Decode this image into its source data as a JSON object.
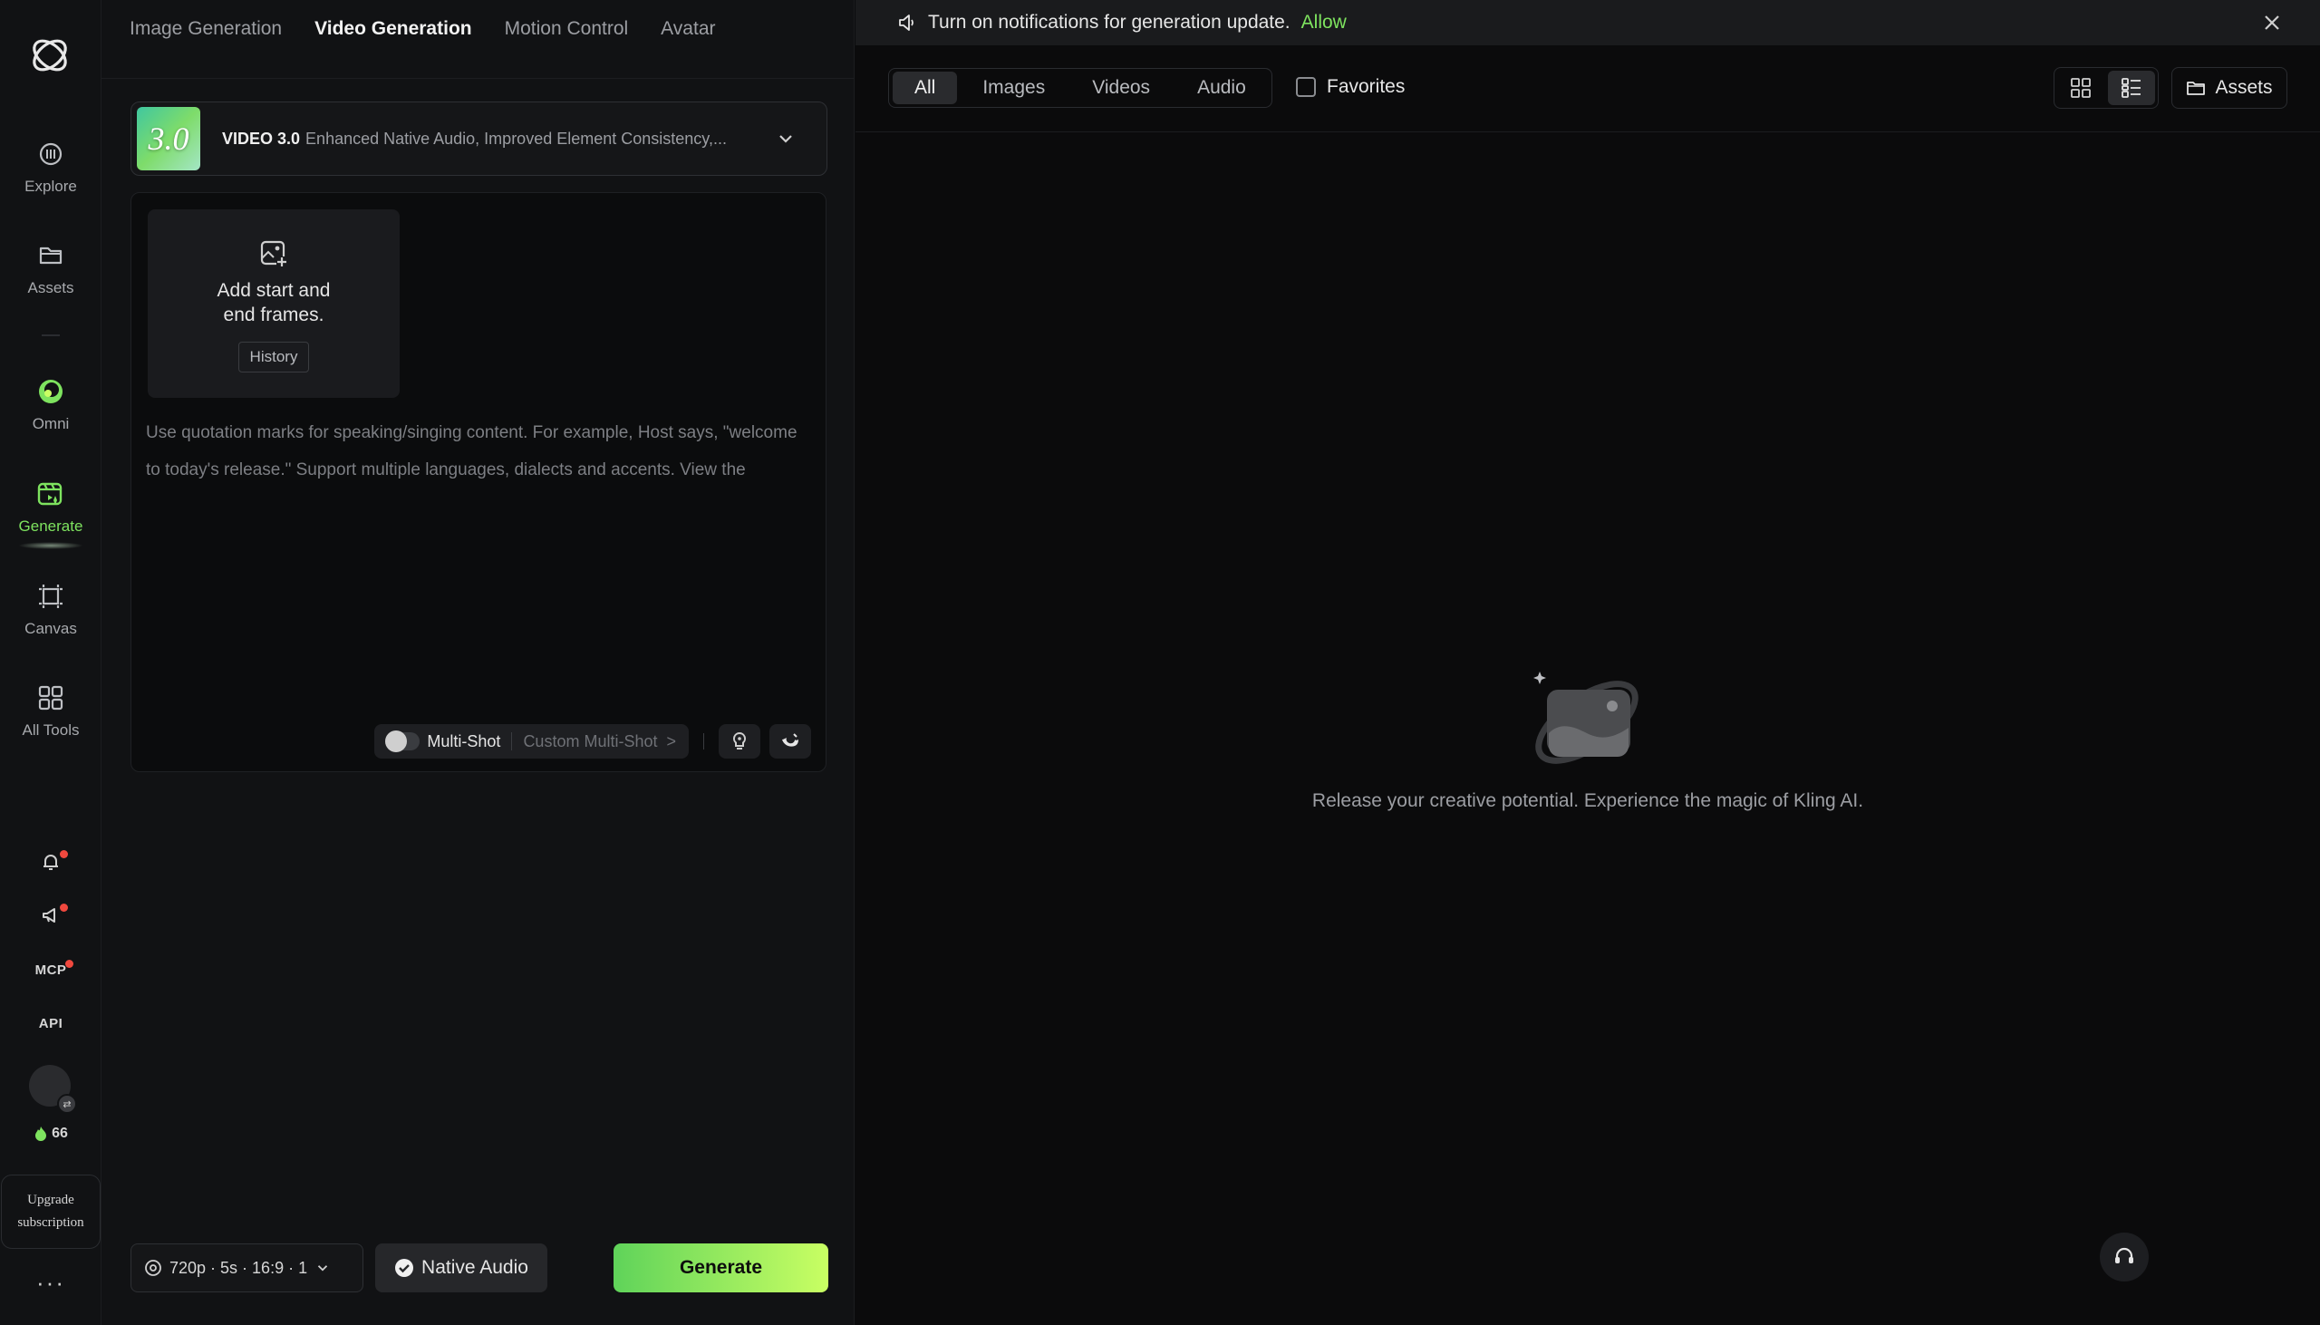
{
  "sidebar": {
    "items": [
      {
        "label": "Explore",
        "icon": "compass-icon"
      },
      {
        "label": "Assets",
        "icon": "folder-icon"
      },
      {
        "label": "Omni",
        "icon": "omni-ring-icon"
      },
      {
        "label": "Generate",
        "icon": "generate-icon"
      },
      {
        "label": "Canvas",
        "icon": "canvas-icon"
      },
      {
        "label": "All Tools",
        "icon": "grid-icon"
      }
    ],
    "mcp_label": "MCP",
    "api_label": "API",
    "credits": "66",
    "upgrade_line1": "Upgrade",
    "upgrade_line2": "subscription",
    "more": "···"
  },
  "top_tabs": [
    {
      "label": "Image Generation",
      "active": false
    },
    {
      "label": "Video Generation",
      "active": true
    },
    {
      "label": "Motion Control",
      "active": false
    },
    {
      "label": "Avatar",
      "active": false
    }
  ],
  "model": {
    "badge": "3.0",
    "name": "VIDEO 3.0",
    "description": "Enhanced Native Audio, Improved Element Consistency,..."
  },
  "frames": {
    "line1": "Add start and",
    "line2": "end frames.",
    "history": "History"
  },
  "prompt": {
    "placeholder": "Use quotation marks for speaking/singing content. For example, Host says, \"welcome to today's release.\" Support multiple languages, dialects and accents. View the"
  },
  "multishot": {
    "label": "Multi-Shot",
    "custom": "Custom Multi-Shot",
    "chevron": ">"
  },
  "settings": {
    "summary": "720p · 5s · 16:9 · 1"
  },
  "audio": {
    "label": "Native Audio",
    "checked": true
  },
  "generate": {
    "label": "Generate"
  },
  "notification": {
    "text": "Turn on notifications for generation update.",
    "allow": "Allow"
  },
  "filters": [
    {
      "label": "All",
      "active": true
    },
    {
      "label": "Images",
      "active": false
    },
    {
      "label": "Videos",
      "active": false
    },
    {
      "label": "Audio",
      "active": false
    }
  ],
  "favorites": {
    "label": "Favorites",
    "checked": false
  },
  "assets_button": "Assets",
  "empty_state": {
    "message": "Release your creative potential. Experience the magic of Kling AI."
  },
  "colors": {
    "accent": "#7ee35f",
    "background": "#0b0c0d",
    "panel": "#111214",
    "alert_dot": "#f0483e"
  }
}
